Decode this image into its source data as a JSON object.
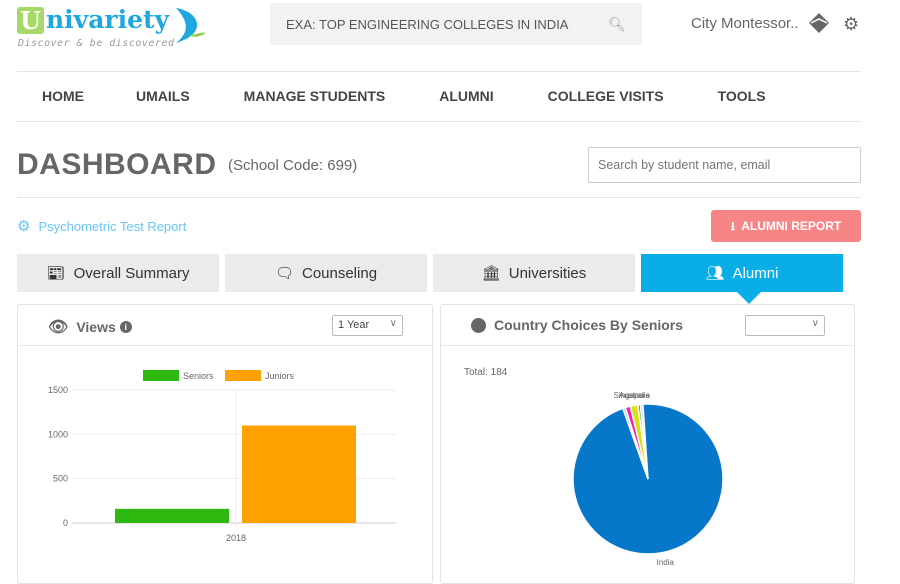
{
  "brand": {
    "name": "nivariety",
    "initial": "U",
    "tagline": "Discover & be discovered"
  },
  "header": {
    "search_placeholder": "EXA: TOP ENGINEERING COLLEGES IN INDIA",
    "user": "City Montessor..",
    "icons": [
      "search-icon",
      "mail-icon",
      "gear-icon"
    ]
  },
  "nav": [
    "HOME",
    "UMAILS",
    "MANAGE STUDENTS",
    "ALUMNI",
    "COLLEGE VISITS",
    "TOOLS"
  ],
  "page": {
    "title": "DASHBOARD",
    "school_code": "(School Code: 699)",
    "student_search_placeholder": "Search by student name, email",
    "psychometric_link": "Psychometric Test Report",
    "alumni_report_button": "ALUMNI REPORT"
  },
  "tabs": [
    {
      "label": "Overall Summary",
      "icon": "newspaper-icon"
    },
    {
      "label": "Counseling",
      "icon": "comments-icon"
    },
    {
      "label": "Universities",
      "icon": "university-icon"
    },
    {
      "label": "Alumni",
      "icon": "users-icon",
      "active": true
    }
  ],
  "colors": {
    "accent": "#0aaee6",
    "report_button": "#f88585",
    "link": "#6cc4ef"
  },
  "views_panel": {
    "title": "Views",
    "period": "1 Year"
  },
  "country_panel": {
    "title": "Country Choices By Seniors",
    "period": ""
  },
  "chart_data": [
    {
      "type": "bar",
      "categories": [
        "2018"
      ],
      "series": [
        {
          "name": "Seniors",
          "values": [
            160
          ],
          "color": "#2db70f"
        },
        {
          "name": "Juniors",
          "values": [
            1100
          ],
          "color": "#ffa100"
        }
      ],
      "yticks": [
        "0",
        "500",
        "1000",
        "1500"
      ],
      "ylim": [
        0,
        1500
      ],
      "legend": "top",
      "grid": true
    },
    {
      "type": "pie",
      "total_label": "Total: 184",
      "slices": [
        {
          "label": "Australia",
          "value": 1,
          "color": "#1aa51a"
        },
        {
          "label": "",
          "value": 1,
          "color": "#ffb6c1"
        },
        {
          "label": "India",
          "value": 176,
          "color": "#0677c9"
        },
        {
          "label": "",
          "value": 1,
          "color": "#7fd3f5"
        },
        {
          "label": "Singapore",
          "value": 2,
          "color": "#ff1fa5"
        },
        {
          "label": "",
          "value": 3,
          "color": "#d6e21a"
        }
      ]
    }
  ]
}
